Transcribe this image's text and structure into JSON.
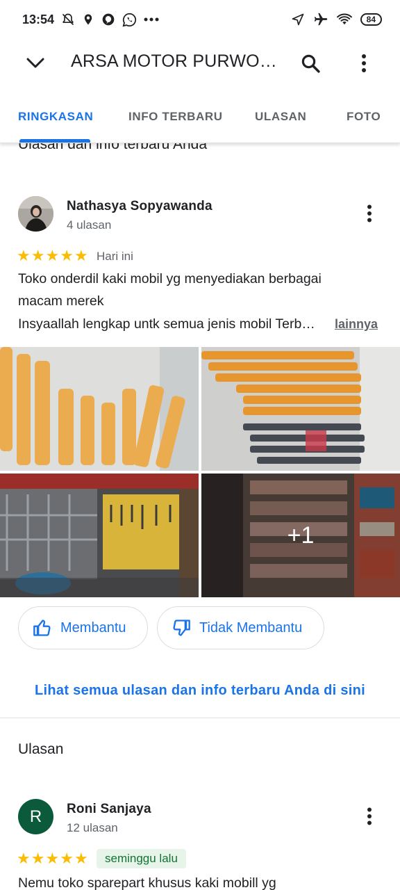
{
  "status_bar": {
    "time": "13:54",
    "battery": "84"
  },
  "app_bar": {
    "title": "ARSA MOTOR PURWOKERTO"
  },
  "tabs": [
    {
      "label": "RINGKASAN",
      "active": true
    },
    {
      "label": "INFO TERBARU",
      "active": false
    },
    {
      "label": "ULASAN",
      "active": false
    },
    {
      "label": "FOTO",
      "active": false
    }
  ],
  "your_section_title": "Ulasan dan info terbaru Anda",
  "review1": {
    "author": "Nathasya Sopyawanda",
    "author_count": "4 ulasan",
    "rating": 5,
    "date": "Hari ini",
    "text_line1": "Toko onderdil kaki mobil yg menyediakan berbagai",
    "text_line2": "macam merek",
    "text_line3": "Insyaallah lengkap untk semua jenis mobil Terb…",
    "more_label": "lainnya",
    "extra_photos": "+1"
  },
  "buttons": {
    "helpful": "Membantu",
    "not_helpful": "Tidak Membantu"
  },
  "see_all_link": "Lihat semua ulasan dan info terbaru Anda di sini",
  "reviews_section_title": "Ulasan",
  "review2": {
    "author": "Roni Sanjaya",
    "avatar_letter": "R",
    "author_count": "12 ulasan",
    "rating": 5,
    "date": "seminggu lalu",
    "text_line1": "Nemu toko sparepart khusus kaki mobill yg"
  },
  "colors": {
    "accent": "#1a73e8",
    "star": "#fbbc04",
    "avatar_r": "#0b5a3c",
    "badge_bg": "#e6f4ea",
    "badge_text": "#137333"
  }
}
